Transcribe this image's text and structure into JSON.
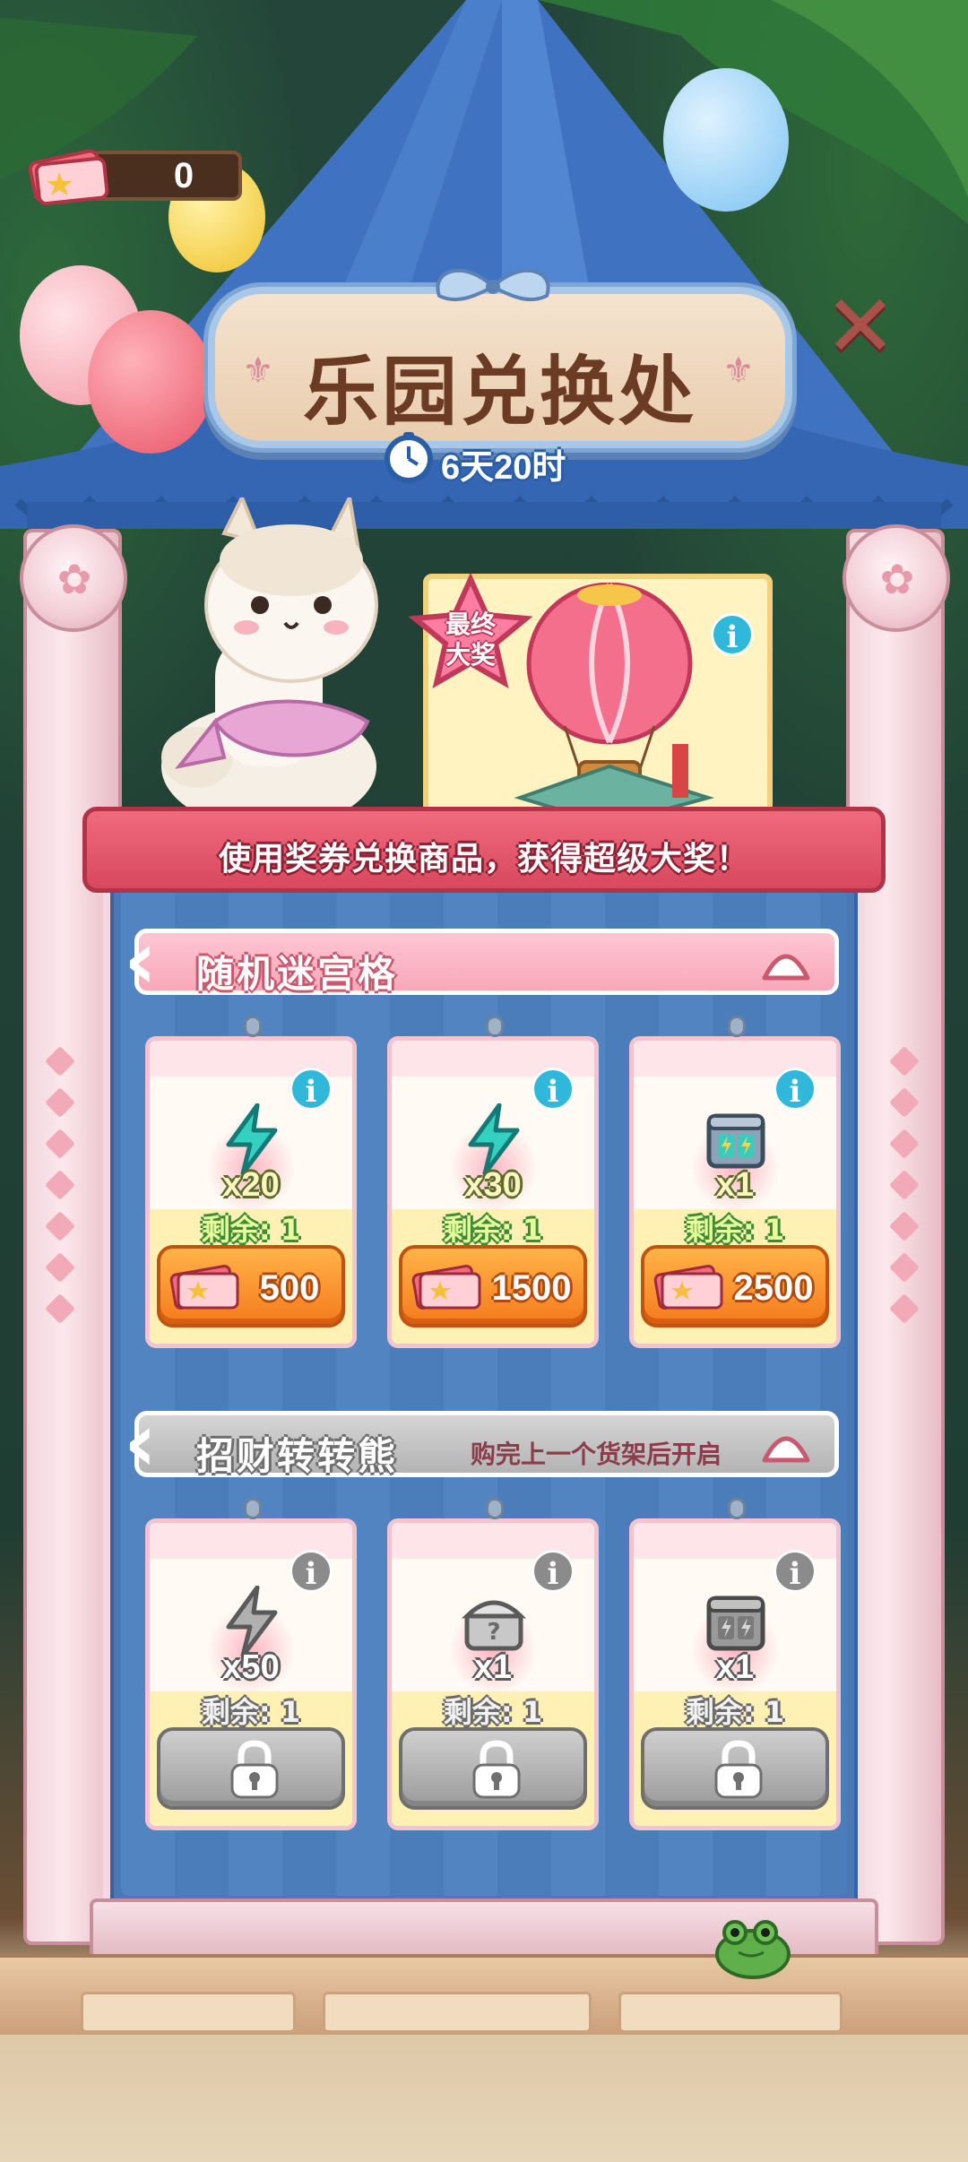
{
  "header": {
    "ticket_count": "0",
    "title": "乐园兑换处",
    "timer": "6天20时"
  },
  "grand_prize": {
    "badge": "最终大奖",
    "item_icon": "hot-air-balloon-icon"
  },
  "banner": {
    "text": "使用奖券兑换商品，获得超级大奖！"
  },
  "sections": [
    {
      "title": "随机迷宫格",
      "note": "",
      "state": "unlocked",
      "items": [
        {
          "icon": "lightning-energy-icon",
          "qty": "x20",
          "remain": "剩余: 1",
          "price": "500"
        },
        {
          "icon": "lightning-energy-icon",
          "qty": "x30",
          "remain": "剩余: 1",
          "price": "1500"
        },
        {
          "icon": "energy-crate-icon",
          "qty": "x1",
          "remain": "剩余: 1",
          "price": "2500"
        }
      ]
    },
    {
      "title": "招财转转熊",
      "note": "购完上一个货架后开启",
      "state": "locked",
      "items": [
        {
          "icon": "lightning-energy-icon",
          "qty": "x50",
          "remain": "剩余: 1"
        },
        {
          "icon": "mystery-chest-icon",
          "qty": "x1",
          "remain": "剩余: 1"
        },
        {
          "icon": "energy-crate-icon",
          "qty": "x1",
          "remain": "剩余: 1"
        }
      ]
    }
  ],
  "colors": {
    "tent_blue": "#3f73c2",
    "board_blue": "#4a79b6",
    "ribbon_red": "#e35a6f",
    "button_orange": "#f57b1d",
    "locked_gray": "#9b9b9b",
    "info_cyan": "#2fb8d9"
  }
}
